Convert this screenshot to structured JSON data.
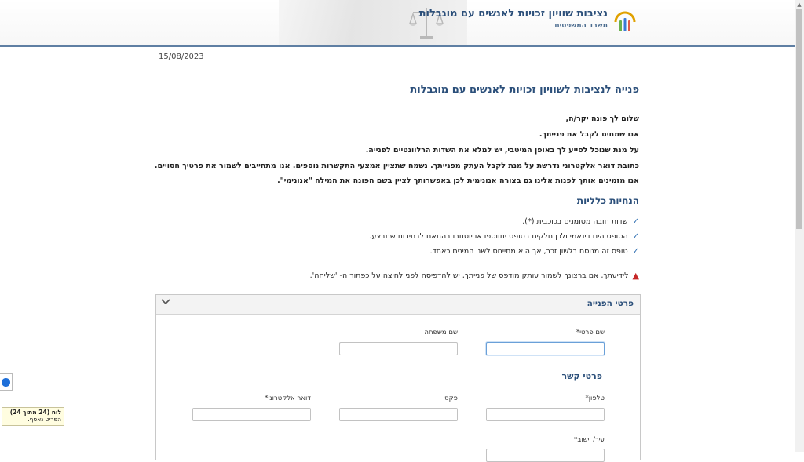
{
  "header": {
    "site_title": "נציבות שוויון זכויות לאנשים עם מוגבלות",
    "site_subtitle": "משרד המשפטים"
  },
  "date": "15/08/2023",
  "page_title": "פנייה לנציבות לשוויון זכויות לאנשים עם מוגבלות",
  "intro": [
    "שלום לך פונה יקר/ה,",
    "אנו שמחים לקבל את פנייתך.",
    "על מנת שנוכל לסייע לך באופן המיטבי, יש למלא את השדות הרלוונטיים לפנייה.",
    "כתובת דואר אלקטרוני נדרשת על מנת לקבל העתק מפנייתך. נשמח שתציין אמצעי התקשרות נוספים. אנו מתחייבים לשמור את פרטיך חסויים.",
    "אנו מזמינים אותך לפנות אלינו גם בצורה אנונימית לכן באפשרותך לציין בשם הפונה את המילה \"אנונימי\"."
  ],
  "guidelines": {
    "heading": "הנחיות כלליות",
    "items": [
      "שדות חובה מסומנים בכוכבית (*).",
      "הטופס הינו דינאמי ולכן חלקים בטופס יתווספו או יוסתרו בהתאם לבחירות שתבצע.",
      "טופס זה מנוסח בלשון זכר, אך הוא מתייחס לשני המינים כאחד."
    ],
    "warning": "לידיעתך, אם ברצונך לשמור עותק מודפס של פנייתך, יש להדפיסה לפני לחיצה על כפתור ה- 'שליחה'."
  },
  "form": {
    "panel_title": "פרטי הפנייה",
    "first_name_label": "שם פרטי*",
    "last_name_label": "שם משפחה",
    "contact_heading": "פרטי קשר",
    "phone_label": "טלפון*",
    "fax_label": "פקס",
    "email_label": "דואר אלקטרוני*",
    "city_label": "עיר/ יישוב*"
  },
  "tooltip": {
    "title": "לוח (24 מתוך 24)",
    "subtitle": "הפריט נאסף."
  },
  "colors": {
    "accent": "#2b4f7a",
    "warning": "#c62828",
    "check": "#2b6cb0"
  }
}
